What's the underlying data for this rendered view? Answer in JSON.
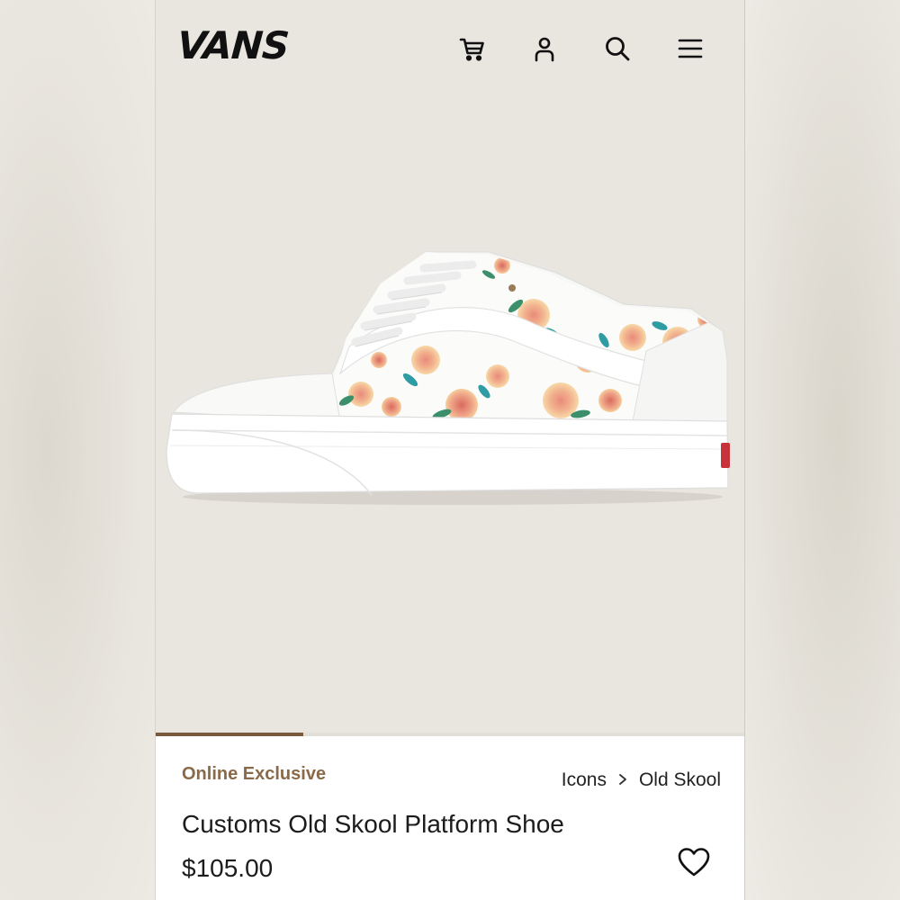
{
  "brand": {
    "logo_text": "VANS"
  },
  "header": {
    "icons": [
      "cart-icon",
      "account-icon",
      "search-icon",
      "menu-icon"
    ]
  },
  "gallery": {
    "progress": 0.25
  },
  "product": {
    "badge": "Online Exclusive",
    "breadcrumb": [
      "Icons",
      "Old Skool"
    ],
    "breadcrumb_separator": ">",
    "title": "Customs Old Skool Platform Shoe",
    "price": "$105.00"
  },
  "colors": {
    "accent": "#8a6a49",
    "progress": "#7a5a3c",
    "background": "#e9e6df",
    "text": "#1c1c1c"
  }
}
